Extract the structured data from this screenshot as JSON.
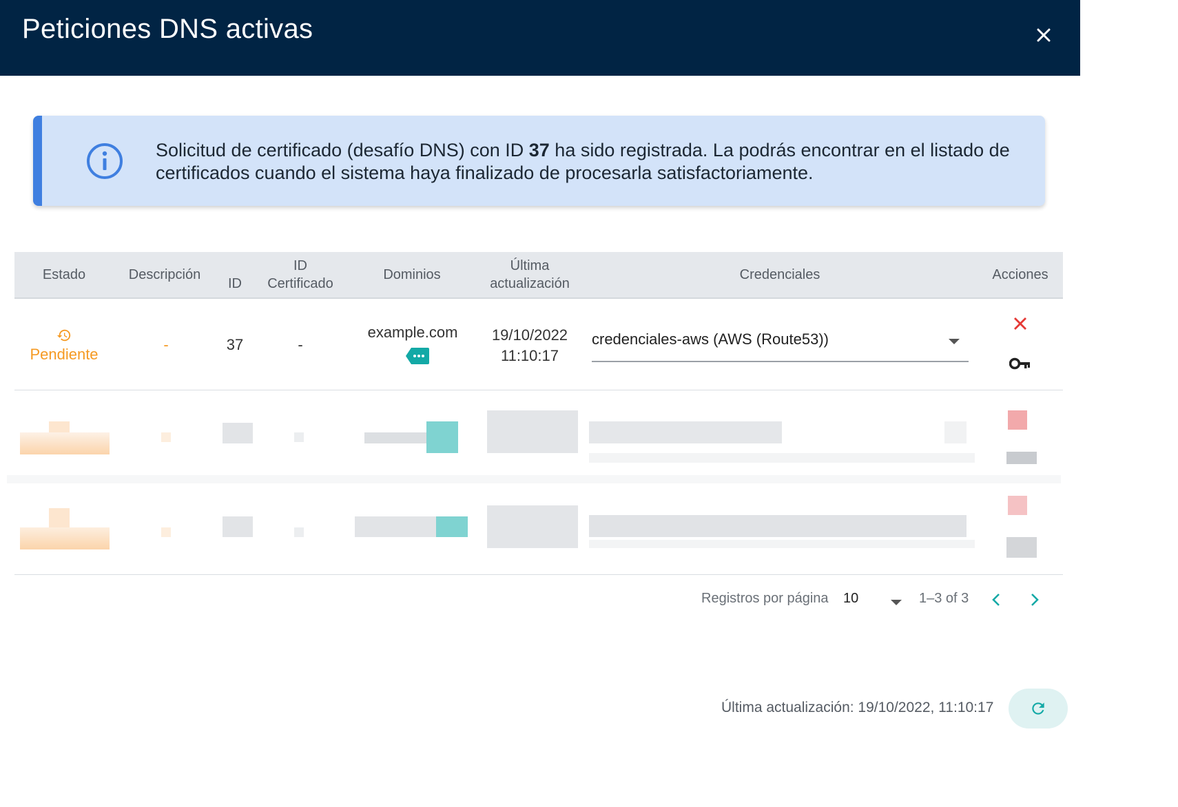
{
  "dialog": {
    "title": "Peticiones DNS activas",
    "close_icon": "close-icon"
  },
  "alert": {
    "icon": "info-icon",
    "message_part1": "Solicitud de certificado (desafío DNS) con ID ",
    "message_id": "37",
    "message_part2": " ha sido registrada. La podrás encontrar en el listado de certificados cuando el sistema haya finalizado de procesarla satisfactoriamente.",
    "accent_color": "#3f7fe0"
  },
  "table": {
    "headers": {
      "estado": "Estado",
      "descripcion": "Descripción",
      "id": "ID",
      "id_cert_1": "ID",
      "id_cert_2": "Certificado",
      "dominios": "Dominios",
      "ultima_1": "Última",
      "ultima_2": "actualización",
      "credenciales": "Credenciales",
      "acciones": "Acciones"
    },
    "rows": [
      {
        "estado": "Pendiente",
        "estado_icon": "history-icon",
        "descripcion": "-",
        "id": "37",
        "id_certificado": "-",
        "dominio": "example.com",
        "dominio_tag_icon": "more-tag-icon",
        "fecha": "19/10/2022",
        "hora": "11:10:17",
        "credencial": "credenciales-aws (AWS (Route53))",
        "actions": [
          "delete-icon",
          "key-icon"
        ]
      }
    ]
  },
  "pagination": {
    "label": "Registros por página",
    "per_page": "10",
    "range": "1–3 of 3"
  },
  "footer": {
    "last_update": "Última actualización: 19/10/2022, 11:10:17",
    "refresh_icon": "refresh-icon"
  },
  "colors": {
    "header_bg": "#012444",
    "pending": "#f59a23",
    "teal": "#13a9a6",
    "delete": "#e53935"
  }
}
